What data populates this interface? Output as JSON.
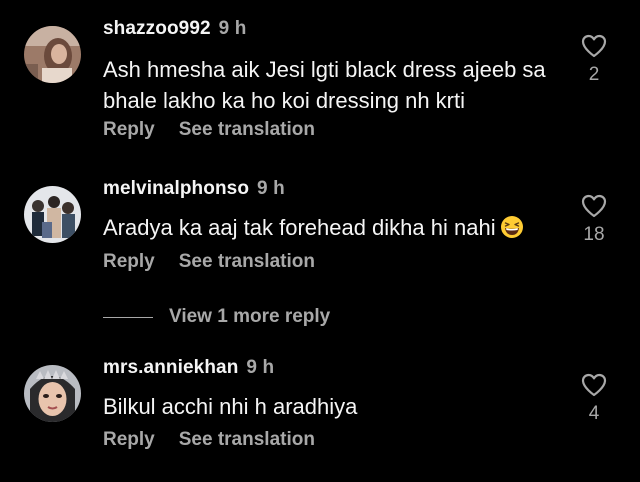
{
  "comments": [
    {
      "username": "shazzoo992",
      "time": "9 h",
      "text": "Ash hmesha aik Jesi lgti black dress ajeeb sa bhale lakho ka ho koi dressing nh krti",
      "reply_label": "Reply",
      "translate_label": "See translation",
      "likes": "2",
      "avatar_icon": "profile-photo"
    },
    {
      "username": "melvinalphonso",
      "time": "9 h",
      "text": "Aradya ka aaj tak forehead dikha hi nahi",
      "emoji": "grinning-squinting-face",
      "reply_label": "Reply",
      "translate_label": "See translation",
      "likes": "18",
      "avatar_icon": "profile-photo"
    },
    {
      "username": "mrs.anniekhan",
      "time": "9 h",
      "text": "Bilkul acchi nhi h aradhiya",
      "reply_label": "Reply",
      "translate_label": "See translation",
      "likes": "4",
      "avatar_icon": "profile-photo"
    }
  ],
  "view_replies_label": "View 1 more reply",
  "colors": {
    "background": "#000000",
    "primary_text": "#f5f5f5",
    "secondary_text": "#a8a8a8"
  },
  "icons": {
    "like": "heart-outline-icon"
  }
}
